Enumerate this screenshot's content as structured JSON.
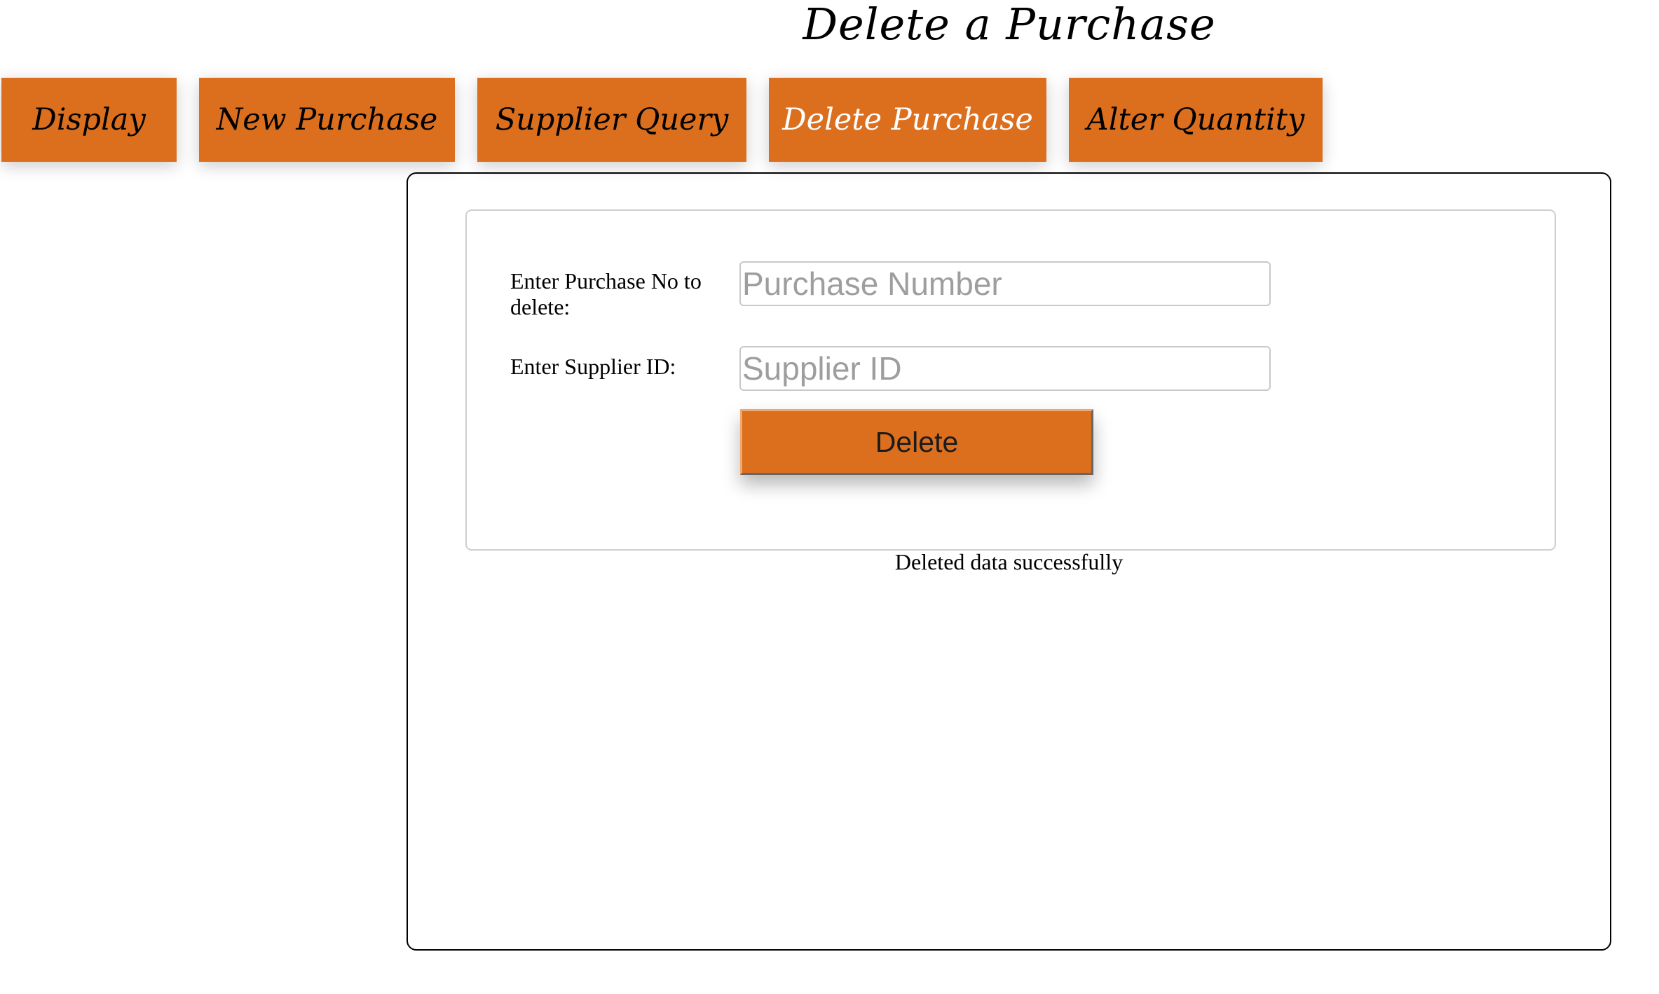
{
  "page": {
    "title": "Delete a Purchase"
  },
  "nav": {
    "items": [
      {
        "label": "Display"
      },
      {
        "label": "New Purchase"
      },
      {
        "label": "Supplier Query"
      },
      {
        "label": "Delete Purchase"
      },
      {
        "label": "Alter Quantity"
      }
    ],
    "active": "Delete Purchase"
  },
  "form": {
    "purchase_label": "Enter Purchase No to delete:",
    "purchase_placeholder": "Purchase Number",
    "purchase_value": "",
    "supplier_label": "Enter Supplier ID:",
    "supplier_placeholder": "Supplier ID",
    "supplier_value": "",
    "delete_label": "Delete"
  },
  "status": {
    "message": "Deleted data successfully"
  },
  "colors": {
    "accent": "#db6f1e",
    "active_text": "#ffffff",
    "text": "#000000"
  }
}
